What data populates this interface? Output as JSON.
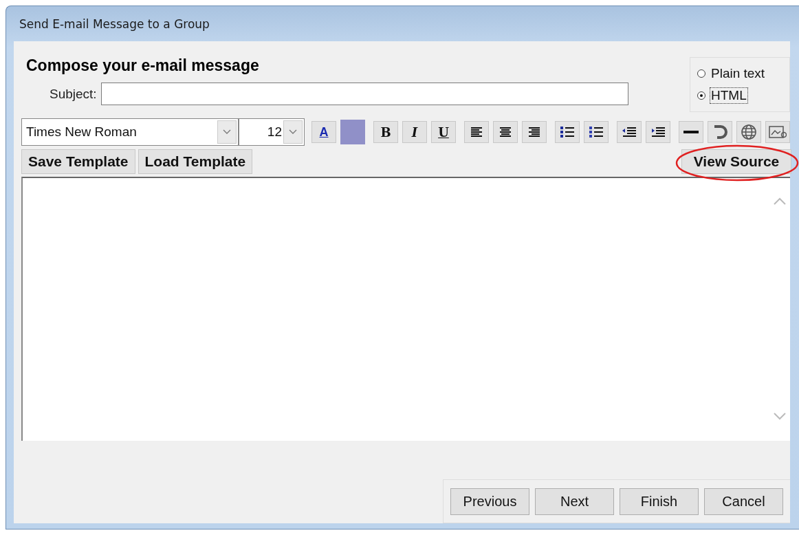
{
  "window": {
    "title": "Send E-mail Message to a Group"
  },
  "heading": "Compose your e-mail message",
  "subject": {
    "label": "Subject:"
  },
  "format_options": [
    {
      "label": "Plain text",
      "selected": false
    },
    {
      "label": "HTML",
      "selected": true
    }
  ],
  "font_select": {
    "value": "Times New Roman"
  },
  "size_select": {
    "value": "12"
  },
  "toolbar": [
    {
      "kind": "fontcolor",
      "text": "A"
    },
    {
      "kind": "swatch",
      "color": "#9090c8"
    },
    {
      "kind": "bold",
      "text": "B"
    },
    {
      "kind": "italic",
      "text": "I"
    },
    {
      "kind": "underline",
      "text": "U"
    },
    {
      "kind": "alignleft"
    },
    {
      "kind": "aligncenter"
    },
    {
      "kind": "alignright"
    },
    {
      "kind": "bullets"
    },
    {
      "kind": "numbers"
    },
    {
      "kind": "outdent"
    },
    {
      "kind": "indent"
    },
    {
      "kind": "rule"
    },
    {
      "kind": "undo"
    },
    {
      "kind": "link"
    },
    {
      "kind": "image"
    }
  ],
  "template_buttons": [
    "Save Template",
    "Load Template"
  ],
  "view_source": {
    "label": "View Source",
    "highlighted": true
  },
  "footer_buttons": [
    "Previous",
    "Next",
    "Finish",
    "Cancel"
  ]
}
